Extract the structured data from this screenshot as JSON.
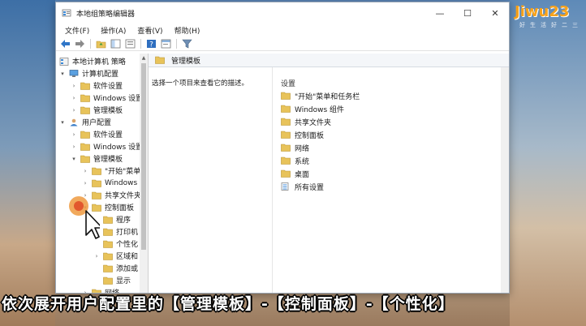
{
  "window": {
    "title": "本地组策略编辑器",
    "controls": {
      "minimize": "—",
      "maximize": "☐",
      "close": "✕"
    }
  },
  "menubar": [
    "文件(F)",
    "操作(A)",
    "查看(V)",
    "帮助(H)"
  ],
  "toolbar": [
    "back-arrow-icon",
    "forward-arrow-icon",
    "up-folder-icon",
    "show-tree-icon",
    "export-icon",
    "help-icon",
    "properties-icon",
    "filter-icon"
  ],
  "tree": {
    "root": "本地计算机 策略",
    "computer_config": "计算机配置",
    "computer_children": [
      "软件设置",
      "Windows 设置",
      "管理模板"
    ],
    "user_config": "用户配置",
    "user_children": [
      "软件设置",
      "Windows 设置",
      "管理模板"
    ],
    "admin_templates_children": [
      "\"开始\"菜单",
      "Windows",
      "共享文件夹",
      "控制面板"
    ],
    "control_panel_children": [
      "程序",
      "打印机",
      "个性化",
      "区域和",
      "添加或",
      "显示"
    ],
    "tail": "网络"
  },
  "right_pane": {
    "header": "管理模板",
    "description": "选择一个项目来查看它的描述。",
    "column_header": "设置",
    "items": [
      "\"开始\"菜单和任务栏",
      "Windows 组件",
      "共享文件夹",
      "控制面板",
      "网络",
      "系统",
      "桌面",
      "所有设置"
    ]
  },
  "watermark": {
    "logo": "Jiwu23",
    "sub": "好生活好二三"
  },
  "caption": "依次展开用户配置里的【管理模板】-【控制面板】-【个性化】",
  "colors": {
    "folder": "#e8c35a",
    "selection": "#cde8ff",
    "accent": "#0078d7"
  }
}
